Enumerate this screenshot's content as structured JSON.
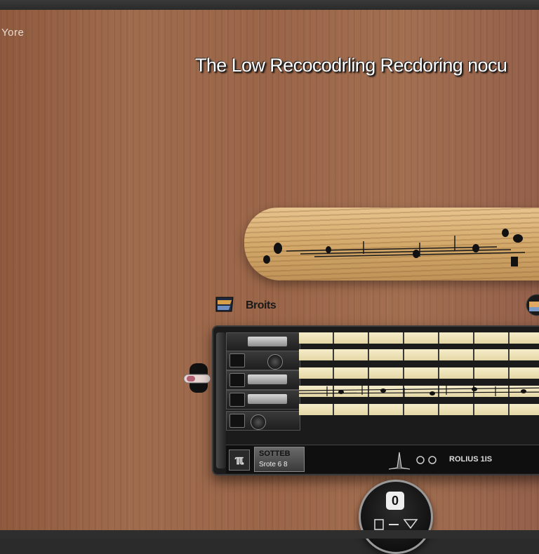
{
  "window": {
    "corner_label": "Yore"
  },
  "header": {
    "title": "The Low  Recocodrling Recdoring nocu"
  },
  "player": {
    "section_label": "Broits",
    "footer_title": "SOTTEB",
    "footer_subtitle": "Srote 6 8",
    "footer_info": "ROLIUS 1IS",
    "round_button_label": "0",
    "track_count": 5
  },
  "colors": {
    "wood": "#9a6548",
    "neck": "#d2a768",
    "track": "#efe4bd",
    "panel": "#1b1b1b"
  },
  "icons": {
    "logo": "boat-logo-icon",
    "knob": "knob-icon",
    "footer": "document-icon",
    "play": "play-triangle-icon"
  }
}
